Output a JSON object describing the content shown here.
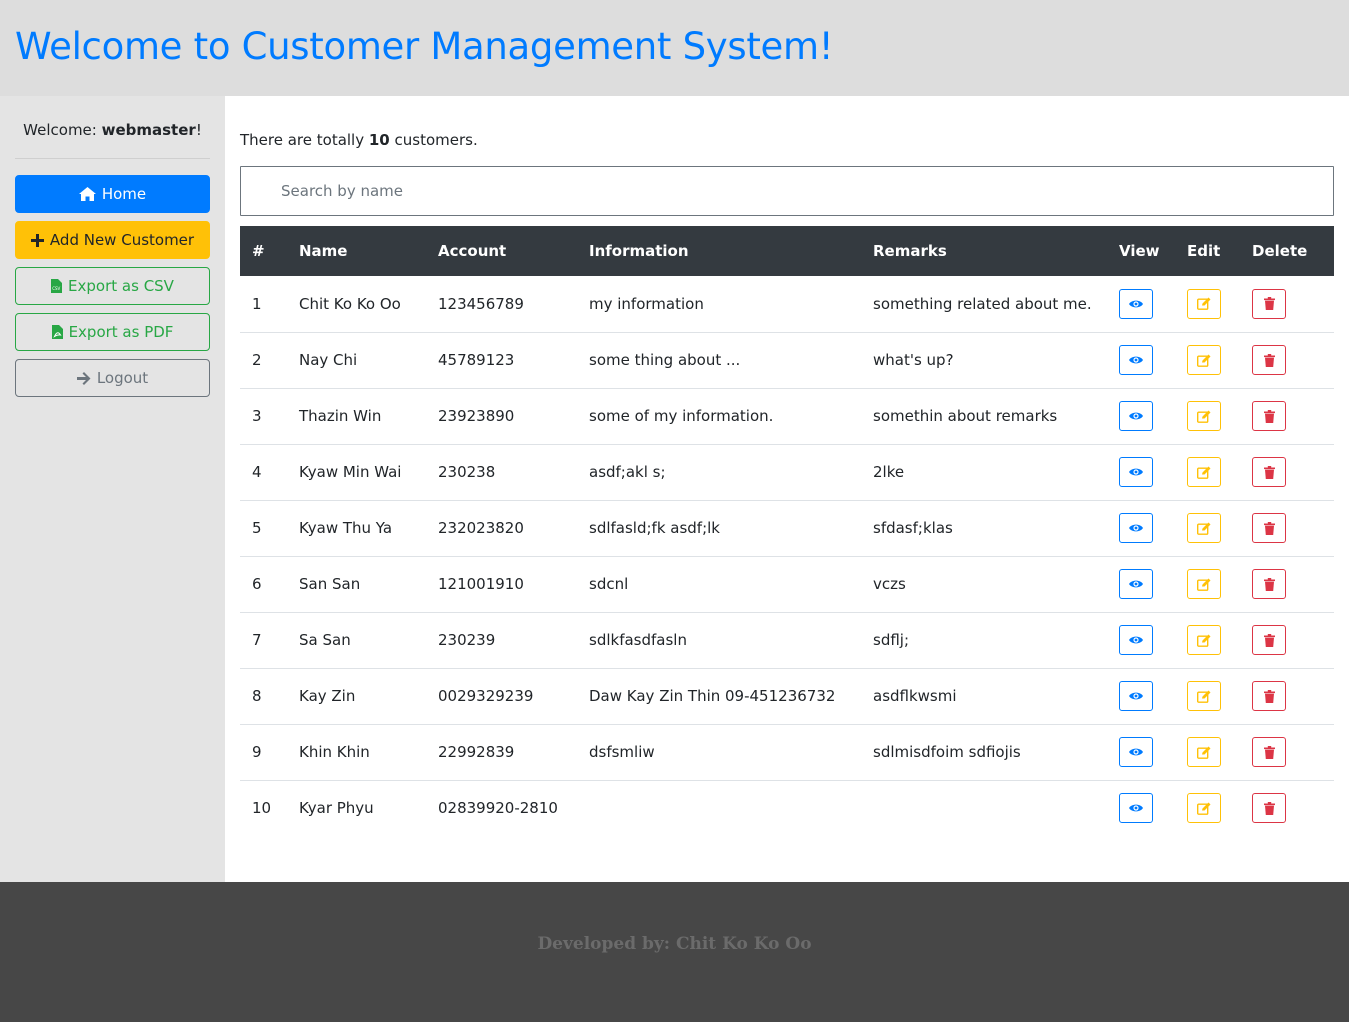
{
  "header": {
    "title": "Welcome to Customer Management System!"
  },
  "sidebar": {
    "welcome_prefix": "Welcome: ",
    "username": "webmaster",
    "welcome_suffix": "!",
    "home_label": "Home",
    "add_label": "Add New Customer",
    "csv_label": "Export as CSV",
    "pdf_label": "Export as PDF",
    "logout_label": "Logout"
  },
  "summary": {
    "prefix": "There are totally ",
    "count": "10",
    "suffix": " customers."
  },
  "search": {
    "placeholder": "Search by name",
    "value": ""
  },
  "table": {
    "headers": {
      "num": "#",
      "name": "Name",
      "account": "Account",
      "information": "Information",
      "remarks": "Remarks",
      "view": "View",
      "edit": "Edit",
      "delete": "Delete"
    },
    "rows": [
      {
        "num": "1",
        "name": "Chit Ko Ko Oo",
        "account": "123456789",
        "information": "my information",
        "remarks": "something related about me."
      },
      {
        "num": "2",
        "name": "Nay Chi",
        "account": "45789123",
        "information": "some thing about ...",
        "remarks": "what's up?"
      },
      {
        "num": "3",
        "name": "Thazin Win",
        "account": "23923890",
        "information": "some of my information.",
        "remarks": "somethin about remarks"
      },
      {
        "num": "4",
        "name": "Kyaw Min Wai",
        "account": "230238",
        "information": "asdf;akl s;",
        "remarks": "2lke"
      },
      {
        "num": "5",
        "name": "Kyaw Thu Ya",
        "account": "232023820",
        "information": "sdlfasld;fk asdf;lk",
        "remarks": "sfdasf;klas"
      },
      {
        "num": "6",
        "name": "San San",
        "account": "121001910",
        "information": "sdcnl",
        "remarks": "vczs"
      },
      {
        "num": "7",
        "name": "Sa San",
        "account": "230239",
        "information": "sdlkfasdfasln",
        "remarks": "sdflj;"
      },
      {
        "num": "8",
        "name": "Kay Zin",
        "account": "0029329239",
        "information": "Daw Kay Zin Thin 09-451236732",
        "remarks": "asdflkwsmi"
      },
      {
        "num": "9",
        "name": "Khin Khin",
        "account": "22992839",
        "information": "dsfsmliw",
        "remarks": "sdlmisdfoim sdfiojis"
      },
      {
        "num": "10",
        "name": "Kyar Phyu",
        "account": "02839920-2810",
        "information": "",
        "remarks": ""
      }
    ]
  },
  "footer": {
    "text": "Developed by: Chit Ko Ko Oo"
  },
  "colors": {
    "primary": "#007bff",
    "warning": "#ffc107",
    "success": "#28a745",
    "danger": "#dc3545",
    "secondary": "#6c757d",
    "dark": "#343a40"
  },
  "icons": {
    "home": "home-icon",
    "add": "plus-icon",
    "csv": "file-csv-icon",
    "pdf": "file-pdf-icon",
    "logout": "arrow-right-icon",
    "view": "eye-icon",
    "edit": "edit-icon",
    "delete": "trash-icon"
  }
}
